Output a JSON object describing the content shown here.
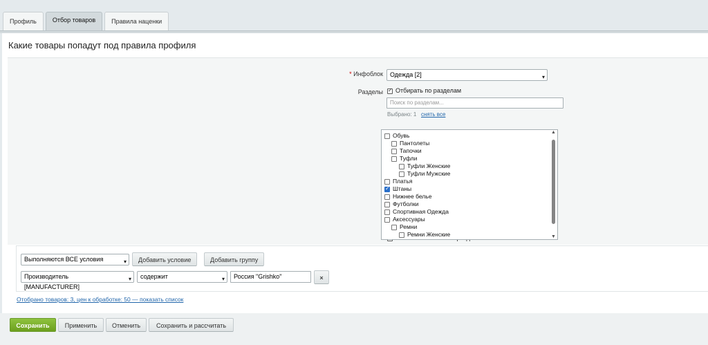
{
  "tabs": [
    {
      "label": "Профиль",
      "active": false
    },
    {
      "label": "Отбор товаров",
      "active": true
    },
    {
      "label": "Правила наценки",
      "active": false
    }
  ],
  "heading": "Какие товары попадут под правила профиля",
  "iblock": {
    "required_mark": "*",
    "label": "Инфоблок",
    "value": "Одежда [2]"
  },
  "sections": {
    "label": "Разделы",
    "filter_label": "Отбирать по разделам",
    "filter_checked": true,
    "search_placeholder": "Поиск по разделам...",
    "selected_text": "Выбрано: 1",
    "clear_link": "снять все",
    "tree": [
      {
        "label": "Обувь",
        "level": 0,
        "checked": false
      },
      {
        "label": "Пантолеты",
        "level": 1,
        "checked": false
      },
      {
        "label": "Тапочки",
        "level": 1,
        "checked": false
      },
      {
        "label": "Туфли",
        "level": 1,
        "checked": false
      },
      {
        "label": "Туфли Женские",
        "level": 2,
        "checked": false
      },
      {
        "label": "Туфли Мужские",
        "level": 2,
        "checked": false
      },
      {
        "label": "Платья",
        "level": 0,
        "checked": false
      },
      {
        "label": "Штаны",
        "level": 0,
        "checked": true
      },
      {
        "label": "Нижнее белье",
        "level": 0,
        "checked": false
      },
      {
        "label": "Футболки",
        "level": 0,
        "checked": false
      },
      {
        "label": "Спортивная Одежда",
        "level": 0,
        "checked": false
      },
      {
        "label": "Аксессуары",
        "level": 0,
        "checked": false
      },
      {
        "label": "Ремни",
        "level": 1,
        "checked": false
      },
      {
        "label": "Ремни Женские",
        "level": 2,
        "checked": false
      }
    ],
    "include_nested_label": "Включая вложенные разделы",
    "include_nested_checked": true
  },
  "conditions": {
    "logic_value": "Выполняются ВСЕ условия",
    "add_condition": "Добавить условие",
    "add_group": "Добавить группу",
    "rule": {
      "field": "Производитель [MANUFACTURER]",
      "operator": "содержит",
      "value": "Россия \"Grishko\"",
      "remove": "×"
    }
  },
  "summary_link": "Отобрано товаров: 3, цен к обработке: 50 — показать список",
  "buttons": {
    "save": "Сохранить",
    "apply": "Применить",
    "cancel": "Отменить",
    "save_calc": "Сохранить и рассчитать"
  },
  "colors": {
    "accent": "#76ad2b",
    "link": "#2166ab",
    "background": "#e4eaed"
  }
}
